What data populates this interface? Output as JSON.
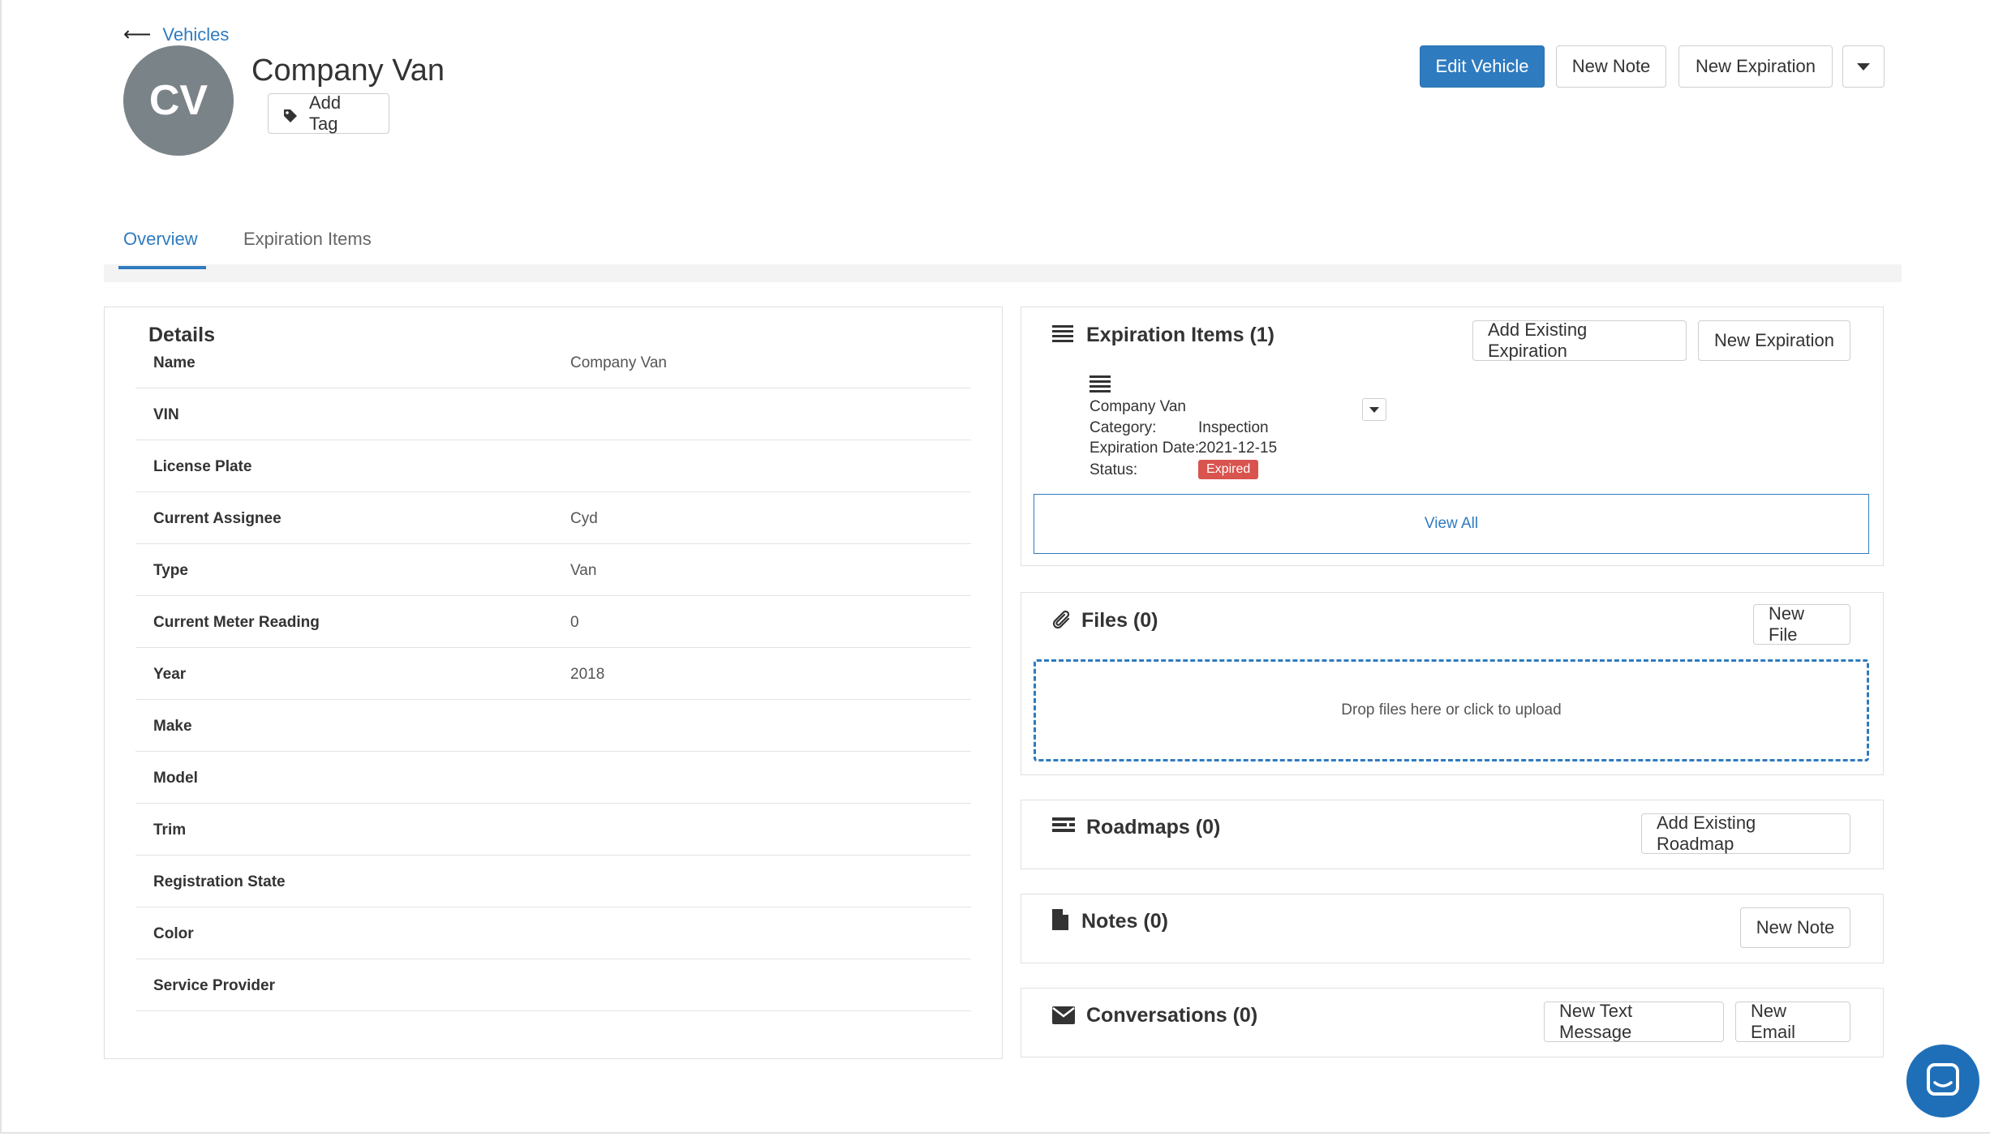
{
  "header": {
    "back_label": "Vehicles",
    "avatar_initials": "CV",
    "title": "Company Van",
    "add_tag_label": "Add Tag",
    "actions": {
      "edit_vehicle": "Edit Vehicle",
      "new_note": "New Note",
      "new_expiration": "New Expiration"
    }
  },
  "tabs": [
    {
      "label": "Overview",
      "active": true
    },
    {
      "label": "Expiration Items",
      "active": false
    }
  ],
  "details": {
    "title": "Details",
    "rows": [
      {
        "label": "Name",
        "value": "Company Van"
      },
      {
        "label": "VIN",
        "value": ""
      },
      {
        "label": "License Plate",
        "value": ""
      },
      {
        "label": "Current Assignee",
        "value": "Cyd"
      },
      {
        "label": "Type",
        "value": "Van"
      },
      {
        "label": "Current Meter Reading",
        "value": "0"
      },
      {
        "label": "Year",
        "value": "2018"
      },
      {
        "label": "Make",
        "value": ""
      },
      {
        "label": "Model",
        "value": ""
      },
      {
        "label": "Trim",
        "value": ""
      },
      {
        "label": "Registration State",
        "value": ""
      },
      {
        "label": "Color",
        "value": ""
      },
      {
        "label": "Service Provider",
        "value": ""
      }
    ]
  },
  "expiration_items": {
    "title": "Expiration Items (1)",
    "add_existing_label": "Add Existing Expiration",
    "new_label": "New Expiration",
    "item": {
      "name": "Company Van",
      "category_label": "Category:",
      "category_value": "Inspection",
      "date_label": "Expiration Date:",
      "date_value": "2021-12-15",
      "status_label": "Status:",
      "status_value": "Expired",
      "status_color": "#d9534f"
    },
    "view_all_label": "View All"
  },
  "files": {
    "title": "Files (0)",
    "new_label": "New File",
    "dropzone_text": "Drop files here or click to upload"
  },
  "roadmaps": {
    "title": "Roadmaps (0)",
    "add_existing_label": "Add Existing Roadmap"
  },
  "notes": {
    "title": "Notes (0)",
    "new_label": "New Note"
  },
  "conversations": {
    "title": "Conversations (0)",
    "new_text_label": "New Text Message",
    "new_email_label": "New Email"
  },
  "colors": {
    "primary": "#2f7bbf",
    "avatar": "#7a8388",
    "chat_button": "#1f6fb8"
  }
}
